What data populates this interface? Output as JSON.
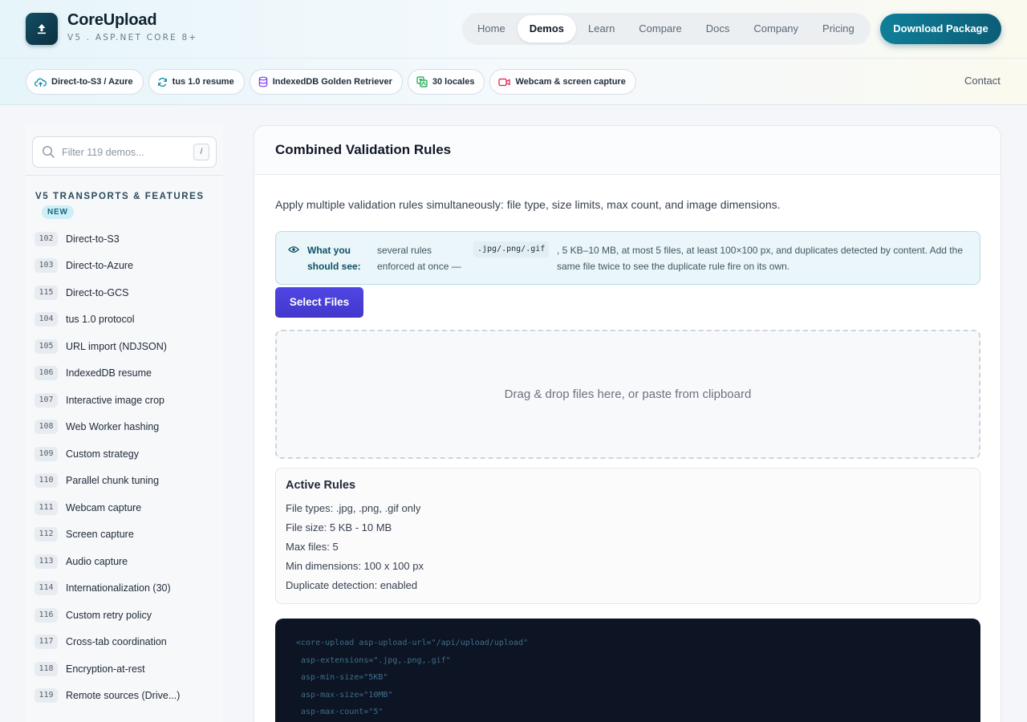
{
  "brand": {
    "name": "CoreUpload",
    "subtitle": "V5 . ASP.NET CORE 8+"
  },
  "nav": {
    "items": [
      {
        "label": "Home",
        "active": false
      },
      {
        "label": "Demos",
        "active": true
      },
      {
        "label": "Learn",
        "active": false
      },
      {
        "label": "Compare",
        "active": false
      },
      {
        "label": "Docs",
        "active": false
      },
      {
        "label": "Company",
        "active": false
      },
      {
        "label": "Pricing",
        "active": false
      }
    ],
    "download_label": "Download Package",
    "contact_label": "Contact"
  },
  "chips": [
    {
      "label": "Direct-to-S3 / Azure",
      "icon": "cloud-upload-icon",
      "color": "#0e8ca3"
    },
    {
      "label": "tus 1.0 resume",
      "icon": "refresh-icon",
      "color": "#0e8ca3"
    },
    {
      "label": "IndexedDB Golden Retriever",
      "icon": "database-icon",
      "color": "#7c3aed"
    },
    {
      "label": "30 locales",
      "icon": "translate-icon",
      "color": "#16a34a"
    },
    {
      "label": "Webcam & screen capture",
      "icon": "video-camera-icon",
      "color": "#e11d48"
    }
  ],
  "sidebar": {
    "search_placeholder": "Filter 119 demos...",
    "search_shortcut": "/",
    "section_title": "V5 TRANSPORTS & FEATURES",
    "section_badge": "NEW",
    "items": [
      {
        "num": "102",
        "label": "Direct-to-S3"
      },
      {
        "num": "103",
        "label": "Direct-to-Azure"
      },
      {
        "num": "115",
        "label": "Direct-to-GCS"
      },
      {
        "num": "104",
        "label": "tus 1.0 protocol"
      },
      {
        "num": "105",
        "label": "URL import (NDJSON)"
      },
      {
        "num": "106",
        "label": "IndexedDB resume"
      },
      {
        "num": "107",
        "label": "Interactive image crop"
      },
      {
        "num": "108",
        "label": "Web Worker hashing"
      },
      {
        "num": "109",
        "label": "Custom strategy"
      },
      {
        "num": "110",
        "label": "Parallel chunk tuning"
      },
      {
        "num": "111",
        "label": "Webcam capture"
      },
      {
        "num": "112",
        "label": "Screen capture"
      },
      {
        "num": "113",
        "label": "Audio capture"
      },
      {
        "num": "114",
        "label": "Internationalization (30)"
      },
      {
        "num": "116",
        "label": "Custom retry policy"
      },
      {
        "num": "117",
        "label": "Cross-tab coordination"
      },
      {
        "num": "118",
        "label": "Encryption-at-rest"
      },
      {
        "num": "119",
        "label": "Remote sources (Drive...)"
      }
    ]
  },
  "main": {
    "title": "Combined Validation Rules",
    "description": "Apply multiple validation rules simultaneously: file type, size limits, max count, and image dimensions.",
    "info": {
      "label": "What you should see:",
      "text_before": "several rules enforced at once —",
      "code": ".jpg/.png/.gif",
      "text_after": ", 5 KB–10 MB, at most 5 files, at least 100×100 px, and duplicates detected by content. Add the same file twice to see the duplicate rule fire on its own."
    },
    "select_button": "Select Files",
    "dropzone_text": "Drag & drop files here, or paste from clipboard",
    "rules_title": "Active Rules",
    "rules": [
      "File types: .jpg, .png, .gif only",
      "File size: 5 KB - 10 MB",
      "Max files: 5",
      "Min dimensions: 100 x 100 px",
      "Duplicate detection: enabled"
    ],
    "code_lines": [
      "<core-upload asp-upload-url=\"/api/upload/upload\"",
      " asp-extensions=\".jpg,.png,.gif\"",
      " asp-min-size=\"5KB\"",
      " asp-max-size=\"10MB\"",
      " asp-max-count=\"5\""
    ]
  }
}
